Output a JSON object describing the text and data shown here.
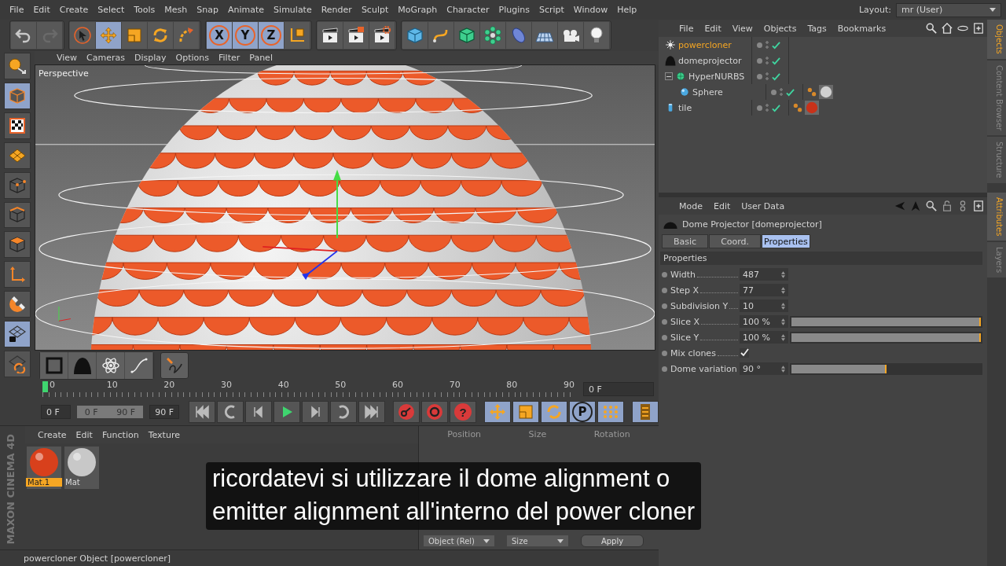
{
  "menubar": {
    "items": [
      "File",
      "Edit",
      "Create",
      "Select",
      "Tools",
      "Mesh",
      "Snap",
      "Animate",
      "Simulate",
      "Render",
      "Sculpt",
      "MoGraph",
      "Character",
      "Plugins",
      "Script",
      "Window",
      "Help"
    ],
    "layout_label": "Layout:",
    "layout_value": "mr (User)"
  },
  "toolbar": {
    "groups": [
      [
        {
          "kind": "undo",
          "selected": false
        },
        {
          "kind": "redo",
          "selected": false
        }
      ],
      [
        {
          "kind": "pointer",
          "selected": false
        },
        {
          "kind": "move",
          "selected": true
        },
        {
          "kind": "scale",
          "selected": false
        },
        {
          "kind": "rotate",
          "selected": false
        },
        {
          "kind": "recent",
          "selected": false
        }
      ],
      [
        {
          "kind": "axis",
          "label": "X",
          "selected": true
        },
        {
          "kind": "axis",
          "label": "Y",
          "selected": true
        },
        {
          "kind": "axis",
          "label": "Z",
          "selected": true
        },
        {
          "kind": "coord",
          "selected": false
        }
      ],
      [
        {
          "kind": "render-view",
          "selected": false
        },
        {
          "kind": "render-pic",
          "selected": false
        },
        {
          "kind": "render-settings",
          "selected": false
        }
      ],
      [
        {
          "kind": "cube",
          "selected": false
        },
        {
          "kind": "spline",
          "selected": false
        },
        {
          "kind": "nurbs",
          "selected": false
        },
        {
          "kind": "cloner",
          "selected": false
        },
        {
          "kind": "deformer",
          "selected": false
        },
        {
          "kind": "floor",
          "selected": false
        },
        {
          "kind": "camera",
          "selected": false
        },
        {
          "kind": "light",
          "selected": false
        }
      ]
    ]
  },
  "left_tools": [
    {
      "kind": "editable",
      "selected": false
    },
    {
      "kind": "model",
      "selected": true
    },
    {
      "kind": "texture",
      "selected": false
    },
    {
      "kind": "workplane",
      "selected": false
    },
    {
      "kind": "points",
      "selected": false
    },
    {
      "kind": "edges",
      "selected": false
    },
    {
      "kind": "polygons",
      "selected": false
    },
    {
      "kind": "axis-mode",
      "selected": false
    },
    {
      "kind": "magnet",
      "selected": false
    },
    {
      "kind": "lock-grid",
      "selected": true
    },
    {
      "kind": "grid-sync",
      "selected": false
    }
  ],
  "viewport": {
    "menu": [
      "View",
      "Cameras",
      "Display",
      "Options",
      "Filter",
      "Panel"
    ],
    "label": "Perspective"
  },
  "palette": [
    {
      "kind": "null"
    },
    {
      "kind": "dome"
    },
    {
      "kind": "atom"
    },
    {
      "kind": "spline-pen"
    },
    {
      "kind": "sketch"
    }
  ],
  "timeline": {
    "ruler": [
      "0",
      "10",
      "20",
      "30",
      "40",
      "50",
      "60",
      "70",
      "80",
      "90"
    ],
    "current_frame": "0 F",
    "start": "0 F",
    "range": {
      "start": "0 F",
      "end": "90 F",
      "level": 1
    },
    "end": "90 F",
    "transport": [
      {
        "kind": "first"
      },
      {
        "kind": "prev-key"
      },
      {
        "kind": "prev"
      },
      {
        "kind": "play"
      },
      {
        "kind": "next"
      },
      {
        "kind": "next-key"
      },
      {
        "kind": "last"
      },
      {
        "kind": "record"
      },
      {
        "kind": "autokey"
      },
      {
        "kind": "help",
        "label": "?"
      },
      {
        "kind": "key-move"
      },
      {
        "kind": "key-scale"
      },
      {
        "kind": "key-rotate"
      },
      {
        "kind": "key-param",
        "label": "P"
      },
      {
        "kind": "key-points"
      },
      {
        "kind": "film"
      }
    ]
  },
  "materials": {
    "menu": [
      "Create",
      "Edit",
      "Function",
      "Texture"
    ],
    "items": [
      {
        "name": "Mat.1",
        "color": "#d8401c",
        "selected": true
      },
      {
        "name": "Mat",
        "color": "#c8c8c8",
        "selected": false
      }
    ],
    "logo": "MAXON CINEMA 4D"
  },
  "coordinates": {
    "headers": [
      "Position",
      "Size",
      "Rotation"
    ],
    "mode": "Object (Rel)",
    "size_mode": "Size",
    "apply": "Apply"
  },
  "subtitle": {
    "lines": [
      "ricordatevi si utilizzare il dome alignment o",
      "emitter alignment all'interno del power cloner"
    ]
  },
  "status_bar": "powercloner Object [powercloner]",
  "objects": {
    "menu": [
      "File",
      "Edit",
      "View",
      "Objects",
      "Tags",
      "Bookmarks"
    ],
    "tree": [
      {
        "name": "powercloner",
        "kind": "star",
        "selected": true,
        "enabled": true
      },
      {
        "name": "domeprojector",
        "kind": "dome",
        "selected": false,
        "enabled": true
      },
      {
        "name": "HyperNURBS",
        "kind": "nurbs",
        "selected": false,
        "enabled": true,
        "expanded": true,
        "children": [
          {
            "name": "Sphere",
            "kind": "sphere",
            "selected": false,
            "enabled": true,
            "tags": [
              {
                "color": "#d0d0d0"
              }
            ]
          }
        ]
      },
      {
        "name": "tile",
        "kind": "cylinder",
        "selected": false,
        "enabled": true,
        "tags": [
          {
            "color": "#c8321a"
          }
        ]
      }
    ]
  },
  "side_tabs_top": [
    {
      "label": "Objects",
      "selected": true
    },
    {
      "label": "Content Browser",
      "selected": false
    },
    {
      "label": "Structure",
      "selected": false
    }
  ],
  "attributes": {
    "menu": [
      "Mode",
      "Edit",
      "User Data"
    ],
    "title": "Dome Projector [domeprojector]",
    "tabs": [
      {
        "label": "Basic",
        "selected": false
      },
      {
        "label": "Coord.",
        "selected": false
      },
      {
        "label": "Properties",
        "selected": true
      }
    ],
    "section": "Properties",
    "params": [
      {
        "kind": "number",
        "label": "Width",
        "value": "487"
      },
      {
        "kind": "number",
        "label": "Step X",
        "value": "77"
      },
      {
        "kind": "number",
        "label": "Subdivision Y",
        "value": "10"
      },
      {
        "kind": "slider",
        "label": "Slice X",
        "value": "100 %",
        "level": 1
      },
      {
        "kind": "slider",
        "label": "Slice Y",
        "value": "100 %",
        "level": 1
      },
      {
        "kind": "checkbox",
        "label": "Mix clones",
        "checked": true
      },
      {
        "kind": "slider",
        "label": "Dome variation",
        "value": "90 °",
        "level": 0.5
      }
    ]
  },
  "side_tabs_bottom": [
    {
      "label": "Attributes",
      "selected": true
    },
    {
      "label": "Layers",
      "selected": false
    }
  ]
}
